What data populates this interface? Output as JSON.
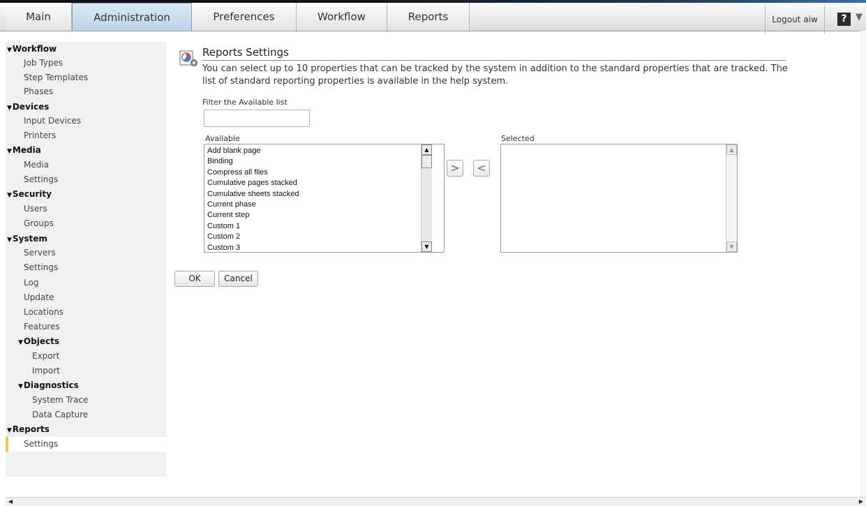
{
  "nav": {
    "tabs": [
      {
        "label": "Main"
      },
      {
        "label": "Administration"
      },
      {
        "label": "Preferences"
      },
      {
        "label": "Workflow"
      },
      {
        "label": "Reports"
      }
    ],
    "logout": "Logout aiw",
    "help": "?"
  },
  "sidebar": {
    "workflow": "Workflow",
    "job_types": "Job Types",
    "step_templates": "Step Templates",
    "phases": "Phases",
    "devices": "Devices",
    "input_devices": "Input Devices",
    "printers": "Printers",
    "media_group": "Media",
    "media": "Media",
    "media_settings": "Settings",
    "security": "Security",
    "users": "Users",
    "groups": "Groups",
    "system": "System",
    "servers": "Servers",
    "system_settings": "Settings",
    "log": "Log",
    "update": "Update",
    "locations": "Locations",
    "features": "Features",
    "objects": "Objects",
    "export": "Export",
    "import": "Import",
    "diagnostics": "Diagnostics",
    "system_trace": "System Trace",
    "data_capture": "Data Capture",
    "reports": "Reports",
    "reports_settings": "Settings"
  },
  "main": {
    "title": "Reports Settings",
    "description": "You can select up to 10 properties that can be tracked by the system in addition to the standard properties that are tracked. The list of standard reporting properties is available in the help system.",
    "filter_label": "Filter the Available list",
    "filter_value": "",
    "available_label": "Available",
    "selected_label": "Selected",
    "available_items": [
      "Add blank page",
      "Binding",
      "Compress all files",
      "Cumulative pages stacked",
      "Cumulative sheets stacked",
      "Current phase",
      "Current step",
      "Custom 1",
      "Custom 2",
      "Custom 3"
    ],
    "selected_items": [],
    "add_button": ">",
    "remove_button": "<",
    "ok": "OK",
    "cancel": "Cancel"
  }
}
